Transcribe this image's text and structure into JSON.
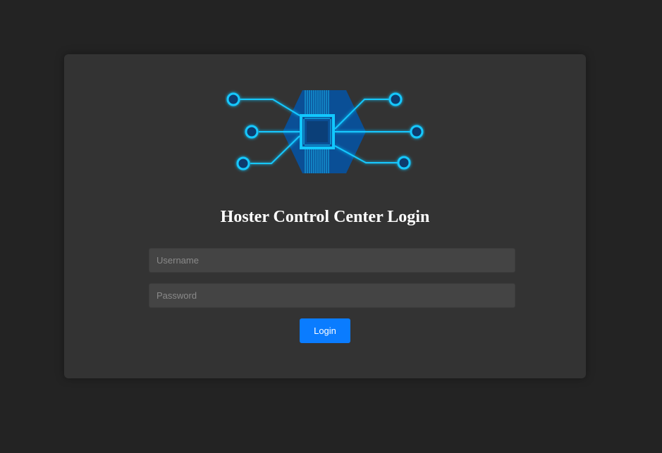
{
  "login": {
    "title": "Hoster Control Center Login",
    "username_placeholder": "Username",
    "password_placeholder": "Password",
    "username_value": "",
    "password_value": "",
    "button_label": "Login"
  },
  "theme": {
    "background": "#232323",
    "card": "#333333",
    "input": "#444444",
    "accent": "#0a7cff",
    "logo_primary": "#00b4ff",
    "logo_hex": "#0a4f96"
  },
  "logo": {
    "icon": "circuit-chip-icon"
  }
}
